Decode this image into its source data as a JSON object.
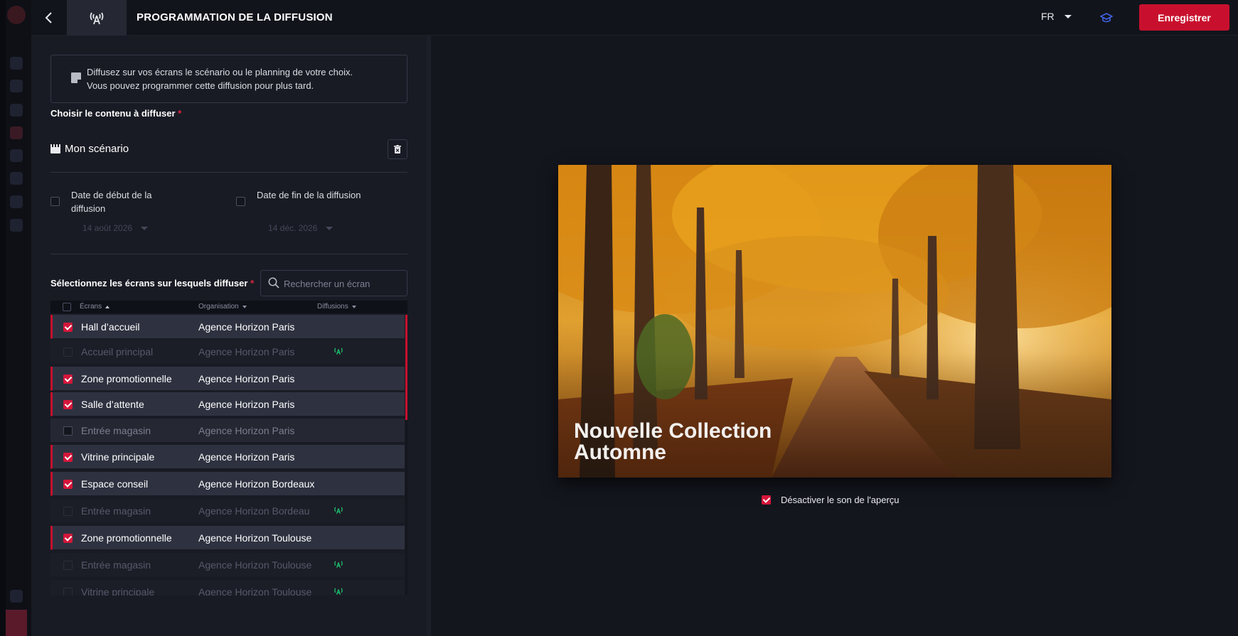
{
  "header": {
    "title": "PROGRAMMATION DE LA DIFFUSION",
    "language": "FR",
    "save_label": "Enregistrer"
  },
  "info": {
    "line1": "Diffusez sur vos écrans le scénario ou le planning de votre choix.",
    "line2": "Vous pouvez programmer cette diffusion pour plus tard."
  },
  "content_section": {
    "label": "Choisir le contenu à diffuser",
    "required_mark": "*",
    "selected": "Mon scénario"
  },
  "dates": {
    "start": {
      "label": "Date de début de la diffusion",
      "value": "14 août 2026",
      "checked": false
    },
    "end": {
      "label": "Date de fin de la diffusion",
      "value": "14 déc. 2026",
      "checked": false
    }
  },
  "screens_section": {
    "label": "Sélectionnez les écrans sur lesquels diffuser",
    "required_mark": "*",
    "search_placeholder": "Rechercher un écran"
  },
  "table": {
    "columns": {
      "screens": "Écrans",
      "organisation": "Organisation",
      "broadcasts": "Diffusions"
    },
    "rows": [
      {
        "name": "Hall d’accueil",
        "org": "Agence Horizon Paris",
        "state": "selected",
        "broadcasting": false
      },
      {
        "name": "Accueil principal",
        "org": "Agence Horizon Paris",
        "state": "disabled",
        "broadcasting": true
      },
      {
        "name": "Zone promotionnelle",
        "org": "Agence Horizon Paris",
        "state": "selected",
        "broadcasting": false
      },
      {
        "name": "Salle d’attente",
        "org": "Agence Horizon Paris",
        "state": "selected",
        "broadcasting": false
      },
      {
        "name": "Entrée magasin",
        "org": "Agence Horizon Paris",
        "state": "unselected",
        "broadcasting": false
      },
      {
        "name": "Vitrine principale",
        "org": "Agence Horizon Paris",
        "state": "selected",
        "broadcasting": false
      },
      {
        "name": "Espace conseil",
        "org": "Agence Horizon Bordeaux",
        "state": "selected",
        "broadcasting": false
      },
      {
        "name": "Entrée magasin",
        "org": "Agence Horizon Bordeau",
        "state": "disabled",
        "broadcasting": true
      },
      {
        "name": "Zone promotionnelle",
        "org": "Agence Horizon Toulouse",
        "state": "selected",
        "broadcasting": false
      },
      {
        "name": "Entrée magasin",
        "org": "Agence Horizon Toulouse",
        "state": "disabled",
        "broadcasting": true
      },
      {
        "name": "Vitrine principale",
        "org": "Agence Horizon Toulouse",
        "state": "disabled",
        "broadcasting": true
      }
    ]
  },
  "preview": {
    "title_line1": "Nouvelle Collection",
    "title_line2": "Automne",
    "mute_label": "Désactiver le son de l'aperçu",
    "mute_checked": true
  },
  "colors": {
    "accent": "#c8102e",
    "broadcast": "#1dbe6e",
    "background": "#14161e",
    "panel": "#191b24"
  },
  "icons": [
    "back-arrow-icon",
    "broadcast-icon",
    "caret-down-icon",
    "graduation-cap-icon",
    "note-icon",
    "clapperboard-icon",
    "trash-icon",
    "search-icon",
    "sort-up-icon",
    "sort-down-icon",
    "checkbox-icon"
  ]
}
